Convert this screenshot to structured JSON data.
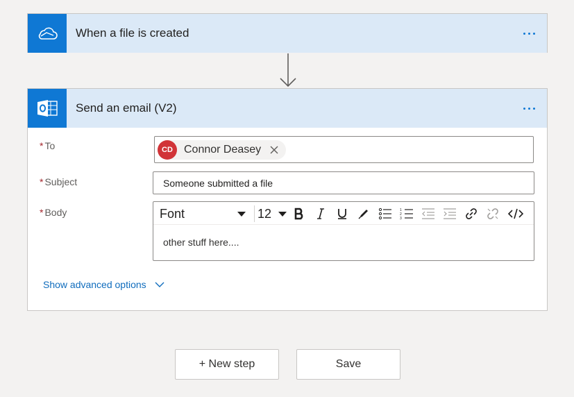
{
  "trigger": {
    "title": "When a file is created",
    "icon": "onedrive-cloud-icon"
  },
  "action": {
    "title": "Send an email (V2)",
    "icon": "outlook-icon",
    "fields": {
      "to": {
        "label": "To",
        "required_mark": "*",
        "recipient": {
          "initials": "CD",
          "name": "Connor Deasey",
          "avatar_color": "#d13438"
        }
      },
      "subject": {
        "label": "Subject",
        "required_mark": "*",
        "value": "Someone submitted a file"
      },
      "body": {
        "label": "Body",
        "required_mark": "*",
        "font": "Font",
        "font_size": "12",
        "content": "other stuff here...."
      }
    },
    "advanced_label": "Show advanced options"
  },
  "buttons": {
    "new_step": "+ New step",
    "save": "Save"
  },
  "colors": {
    "accent": "#0f78d4",
    "header_bg": "#dbe9f7",
    "required": "#a4262c",
    "link": "#0f6cbd"
  }
}
